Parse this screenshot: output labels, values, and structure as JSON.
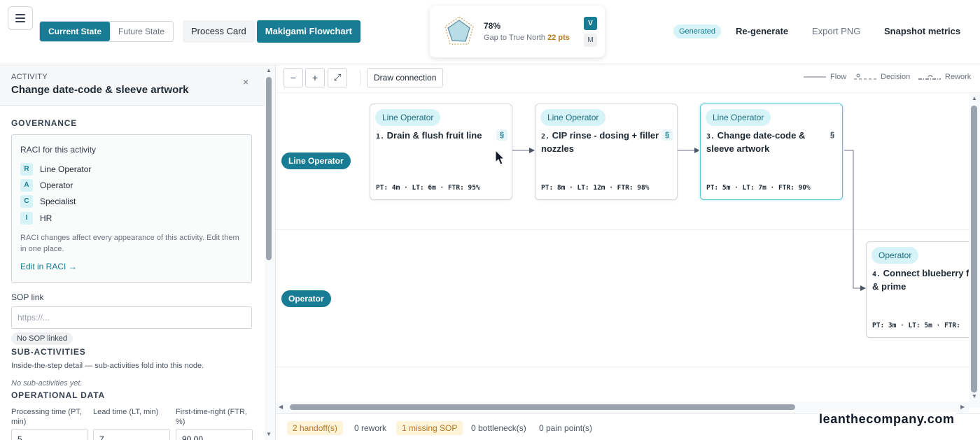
{
  "header": {
    "state_toggle": {
      "current": "Current State",
      "future": "Future State"
    },
    "tabs": [
      {
        "label": "Process Card"
      },
      {
        "label": "Makigami Flowchart"
      }
    ],
    "score": {
      "percent": "78%",
      "gap_label": "Gap to True North",
      "gap_value": "22 pts",
      "badge_v": "V",
      "badge_m": "M"
    },
    "generated_badge": "Generated",
    "regenerate": "Re-generate",
    "export_png": "Export PNG",
    "snapshot_metrics": "Snapshot metrics"
  },
  "sidebar": {
    "kicker": "ACTIVITY",
    "title": "Change date-code & sleeve artwork",
    "close": "×",
    "governance": {
      "heading": "GOVERNANCE",
      "raci_title": "RACI for this activity",
      "raci": [
        {
          "letter": "R",
          "role": "Line Operator"
        },
        {
          "letter": "A",
          "role": "Operator"
        },
        {
          "letter": "C",
          "role": "Specialist"
        },
        {
          "letter": "I",
          "role": "HR"
        }
      ],
      "note": "RACI changes affect every appearance of this activity. Edit them in one place.",
      "edit_link": "Edit in RACI →"
    },
    "sop": {
      "label": "SOP link",
      "placeholder": "https://...",
      "status": "No SOP linked"
    },
    "sub_activities": {
      "heading": "SUB-ACTIVITIES",
      "description": "Inside-the-step detail — sub-activities fold into this node.",
      "empty": "No sub-activities yet."
    },
    "operational": {
      "heading": "OPERATIONAL DATA",
      "pt_label": "Processing time (PT, min)",
      "lt_label": "Lead time (LT, min)",
      "ftr_label": "First-time-right (FTR, %)",
      "pt_value": "5",
      "lt_value": "7",
      "ftr_value": "90.00"
    }
  },
  "canvas": {
    "toolbar": {
      "zoom_out": "−",
      "zoom_in": "+",
      "fit": "⤢",
      "draw_connection": "Draw connection"
    },
    "legend": {
      "flow": "Flow",
      "decision": "Decision",
      "rework": "Rework"
    },
    "lanes": [
      {
        "label": "Line Operator"
      },
      {
        "label": "Operator"
      }
    ],
    "nodes": [
      {
        "lane": "Line Operator",
        "num": "1.",
        "title": "Drain & flush fruit line",
        "sop": "§",
        "metrics": "PT: 4m · LT: 6m · FTR: 95%"
      },
      {
        "lane": "Line Operator",
        "num": "2.",
        "title": "CIP rinse - dosing + filler nozzles",
        "sop": "§",
        "metrics": "PT: 8m · LT: 12m · FTR: 98%"
      },
      {
        "lane": "Line Operator",
        "num": "3.",
        "title": "Change date-code & sleeve artwork",
        "sop": "§",
        "metrics": "PT: 5m · LT: 7m · FTR: 90%"
      },
      {
        "lane": "Operator",
        "num": "4.",
        "title": "Connect blueberry f & prime",
        "sop": "",
        "metrics": "PT: 3m · LT: 5m · FTR:"
      }
    ],
    "status": {
      "handoffs": "2 handoff(s)",
      "rework": "0 rework",
      "missing_sop": "1 missing SOP",
      "bottlenecks": "0 bottleneck(s)",
      "pain_points": "0 pain point(s)"
    }
  },
  "brand": "leanthecompany.com",
  "colors": {
    "accent": "#177c94",
    "accent_light": "#d6f3f7",
    "warning": "#b7791f"
  }
}
